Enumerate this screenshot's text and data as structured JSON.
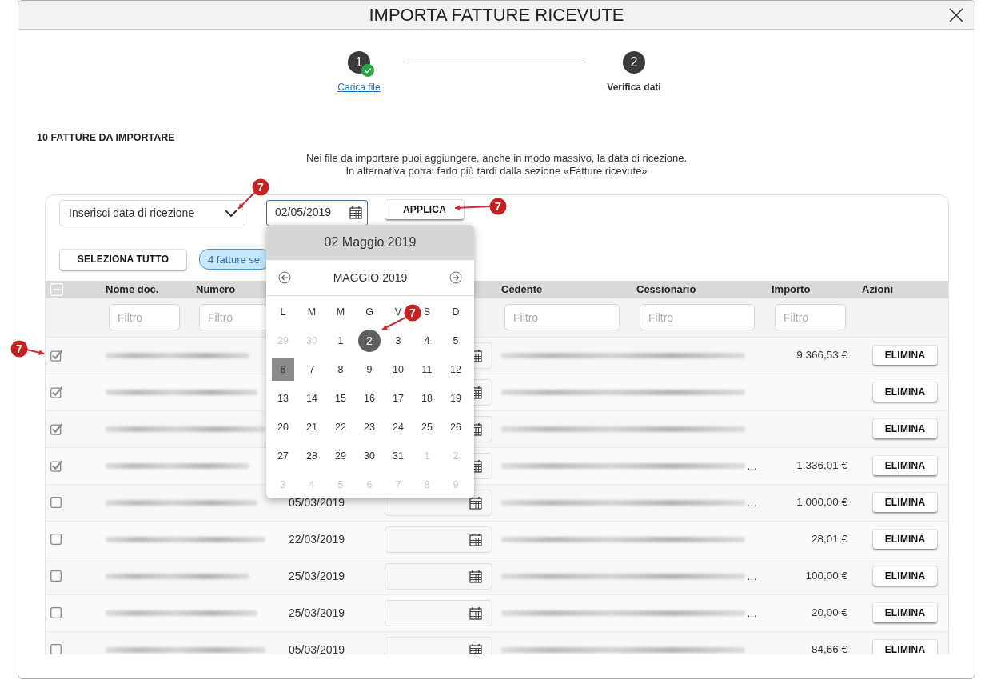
{
  "window": {
    "title": "IMPORTA FATTURE RICEVUTE"
  },
  "steps": [
    {
      "number": "1",
      "label": "Carica file",
      "done": true,
      "selected": false
    },
    {
      "number": "2",
      "label": "Verifica dati",
      "done": false,
      "selected": true
    }
  ],
  "heading": "10 FATTURE DA IMPORTARE",
  "intro": [
    "Nei file da importare puoi aggiungere, anche in modo massivo, la data di ricezione.",
    "In alternativa potrai farlo più tardi dalla sezione «Fatture ricevute»"
  ],
  "bulk": {
    "select": "Inserisci data di ricezione",
    "date": "02/05/2019",
    "apply": "APPLICA",
    "select_all": "SELEZIONA TUTTO",
    "selection_badge": "4 fatture sel"
  },
  "table": {
    "header_checkbox": {
      "indeterminate": true
    },
    "columns": [
      "Nome doc.",
      "Numero",
      "Cedente",
      "Cessionario",
      "Importo",
      "Azioni"
    ],
    "filters": [
      {
        "placeholder": "Filtro"
      },
      {
        "placeholder": "Filtro"
      },
      {
        "placeholder": "Filtro"
      },
      {
        "placeholder": "Filtro"
      },
      {
        "placeholder": "Filtro"
      }
    ],
    "rows": [
      {
        "checked": true,
        "importo": "9.366,53 €",
        "action": "ELIMINA"
      },
      {
        "checked": true,
        "action": "ELIMINA"
      },
      {
        "checked": true,
        "action": "ELIMINA"
      },
      {
        "checked": true,
        "cessionario": "…",
        "importo": "1.336,01 €",
        "action": "ELIMINA"
      },
      {
        "checked": false,
        "date": "05/03/2019",
        "cessionario": "…",
        "importo": "1.000,00 €",
        "action": "ELIMINA"
      },
      {
        "checked": false,
        "date": "22/03/2019",
        "importo": "28,01 €",
        "action": "ELIMINA"
      },
      {
        "checked": false,
        "date": "25/03/2019",
        "cessionario": "…",
        "importo": "100,00 €",
        "action": "ELIMINA"
      },
      {
        "checked": false,
        "date": "25/03/2019",
        "cessionario": "…",
        "importo": "20,00 €",
        "action": "ELIMINA"
      },
      {
        "checked": false,
        "date": "05/03/2019",
        "importo": "84,66 €",
        "action": "ELIMINA"
      }
    ]
  },
  "calendar": {
    "header": "02 Maggio 2019",
    "month": "MAGGIO 2019",
    "weekdays": [
      "L",
      "M",
      "M",
      "G",
      "V",
      "S",
      "D"
    ],
    "days": [
      {
        "label": "29",
        "kind": "other",
        "selected": false,
        "today": false
      },
      {
        "label": "30",
        "kind": "other",
        "selected": false,
        "today": false
      },
      {
        "label": "1",
        "kind": "day",
        "selected": false,
        "today": false
      },
      {
        "label": "2",
        "kind": "day",
        "selected": true,
        "today": false
      },
      {
        "label": "3",
        "kind": "day",
        "selected": false,
        "today": false
      },
      {
        "label": "4",
        "kind": "day",
        "selected": false,
        "today": false
      },
      {
        "label": "5",
        "kind": "day",
        "selected": false,
        "today": false
      },
      {
        "label": "6",
        "kind": "day",
        "selected": false,
        "today": true
      },
      {
        "label": "7",
        "kind": "day",
        "selected": false,
        "today": false
      },
      {
        "label": "8",
        "kind": "day",
        "selected": false,
        "today": false
      },
      {
        "label": "9",
        "kind": "day",
        "selected": false,
        "today": false
      },
      {
        "label": "10",
        "kind": "day",
        "selected": false,
        "today": false
      },
      {
        "label": "11",
        "kind": "day",
        "selected": false,
        "today": false
      },
      {
        "label": "12",
        "kind": "day",
        "selected": false,
        "today": false
      },
      {
        "label": "13",
        "kind": "day",
        "selected": false,
        "today": false
      },
      {
        "label": "14",
        "kind": "day",
        "selected": false,
        "today": false
      },
      {
        "label": "15",
        "kind": "day",
        "selected": false,
        "today": false
      },
      {
        "label": "16",
        "kind": "day",
        "selected": false,
        "today": false
      },
      {
        "label": "17",
        "kind": "day",
        "selected": false,
        "today": false
      },
      {
        "label": "18",
        "kind": "day",
        "selected": false,
        "today": false
      },
      {
        "label": "19",
        "kind": "day",
        "selected": false,
        "today": false
      },
      {
        "label": "20",
        "kind": "day",
        "selected": false,
        "today": false
      },
      {
        "label": "21",
        "kind": "day",
        "selected": false,
        "today": false
      },
      {
        "label": "22",
        "kind": "day",
        "selected": false,
        "today": false
      },
      {
        "label": "23",
        "kind": "day",
        "selected": false,
        "today": false
      },
      {
        "label": "24",
        "kind": "day",
        "selected": false,
        "today": false
      },
      {
        "label": "25",
        "kind": "day",
        "selected": false,
        "today": false
      },
      {
        "label": "26",
        "kind": "day",
        "selected": false,
        "today": false
      },
      {
        "label": "27",
        "kind": "day",
        "selected": false,
        "today": false
      },
      {
        "label": "28",
        "kind": "day",
        "selected": false,
        "today": false
      },
      {
        "label": "29",
        "kind": "day",
        "selected": false,
        "today": false
      },
      {
        "label": "30",
        "kind": "day",
        "selected": false,
        "today": false
      },
      {
        "label": "31",
        "kind": "day",
        "selected": false,
        "today": false
      },
      {
        "label": "1",
        "kind": "other",
        "selected": false,
        "today": false
      },
      {
        "label": "2",
        "kind": "other",
        "selected": false,
        "today": false
      },
      {
        "label": "3",
        "kind": "other",
        "selected": false,
        "today": false
      },
      {
        "label": "4",
        "kind": "other",
        "selected": false,
        "today": false
      },
      {
        "label": "5",
        "kind": "other",
        "selected": false,
        "today": false
      },
      {
        "label": "6",
        "kind": "other",
        "selected": false,
        "today": false
      },
      {
        "label": "7",
        "kind": "other",
        "selected": false,
        "today": false
      },
      {
        "label": "8",
        "kind": "other",
        "selected": false,
        "today": false
      },
      {
        "label": "9",
        "kind": "other",
        "selected": false,
        "today": false
      }
    ]
  },
  "callouts": [
    {
      "label": "7"
    },
    {
      "label": "7"
    },
    {
      "label": "7"
    },
    {
      "label": "7"
    }
  ]
}
